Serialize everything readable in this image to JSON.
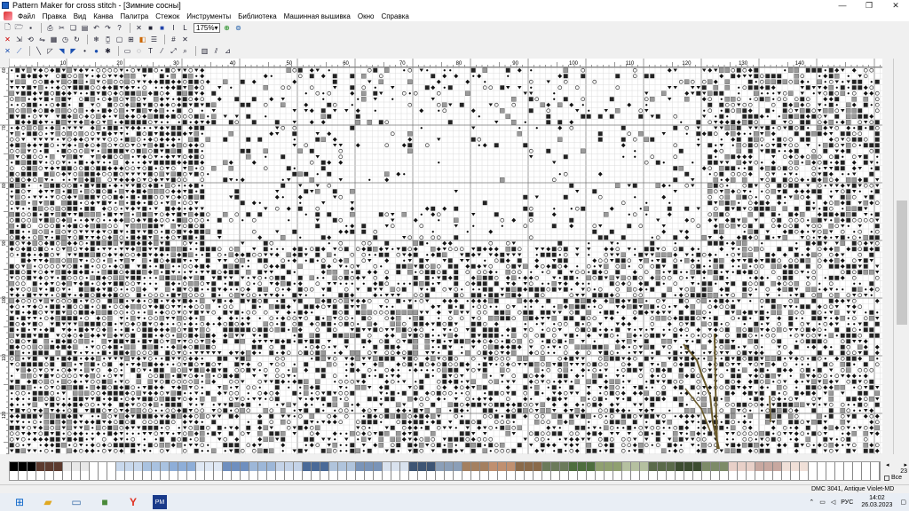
{
  "window": {
    "title": "Pattern Maker for cross stitch - [Зимние сосны]",
    "minimize_glyph": "—",
    "restore_glyph": "❐",
    "close_glyph": "✕"
  },
  "menu": [
    "Файл",
    "Правка",
    "Вид",
    "Канва",
    "Палитра",
    "Стежок",
    "Инструменты",
    "Библиотека",
    "Машинная вышивка",
    "Окно",
    "Справка"
  ],
  "toolbar": {
    "zoom_value": "175%"
  },
  "rulers": {
    "top_labels": [
      "10",
      "20",
      "30",
      "40",
      "50",
      "60",
      "70",
      "80",
      "90",
      "100",
      "110",
      "120",
      "130",
      "140"
    ],
    "left_labels": [
      "60",
      "70",
      "80",
      "90",
      "100",
      "110",
      "120"
    ]
  },
  "palette": {
    "colors": [
      "#000000",
      "#5c3a2e",
      "#e8e8e8",
      "#ffffff",
      "#c8d8ec",
      "#a9c2e0",
      "#8eaed8",
      "#dfe8f4",
      "#6f8fbf",
      "#9db7d8",
      "#c4d3e8",
      "#4a6a98",
      "#b0c4dc",
      "#7a94b8",
      "#d9e2ee",
      "#3e5574",
      "#8b9fb8",
      "#a48060",
      "#c09070",
      "#8a6a4a",
      "#6b7a5a",
      "#4e6e3e",
      "#90a070",
      "#b5c0a0",
      "#5a6a4a",
      "#3c4c30",
      "#7d8b68",
      "#e8d0c8",
      "#c8a8a0",
      "#f0e0d8",
      "#ffffff",
      "#ffffff",
      "#ffffff"
    ],
    "page_count": "23",
    "all_label": "Все"
  },
  "status": {
    "color_info": "DMC  3041, Antique Violet-MD"
  },
  "taskbar": {
    "lang": "РУС",
    "time": "14:02",
    "date": "26.03.2023"
  },
  "icons": {
    "start": "windows-start-icon",
    "explorer": "folder-icon",
    "monitor": "monitor-icon",
    "minecraft": "cube-icon",
    "yandex": "yandex-icon",
    "patternmaker": "pm-icon"
  }
}
